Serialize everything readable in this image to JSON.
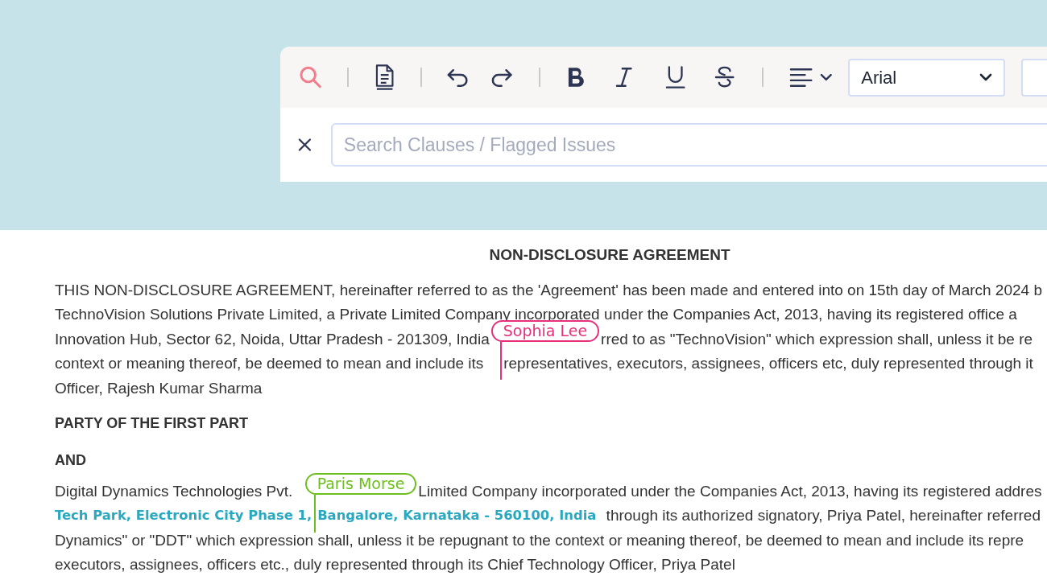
{
  "toolbar": {
    "font": "Arial"
  },
  "search": {
    "placeholder": "Search Clauses / Flagged Issues"
  },
  "document": {
    "title": "NON-DISCLOSURE AGREEMENT",
    "blocks": [
      {
        "kind": "paragraph",
        "lines": [
          [
            {
              "kind": "text",
              "text": "THIS NON-DISCLOSURE AGREEMENT, hereinafter referred to as the 'Agreement' has been made and entered into on 15th day of March 2024 b"
            }
          ],
          [
            {
              "kind": "text",
              "text": "TechnoVision Solutions Private Limited, a Private Limited Company incorporated under the Companies Act, 2013, having its registered office a"
            }
          ],
          [
            {
              "kind": "text",
              "text": "Innovation Hub, Sector 62, Noida, Uttar Pradesh - 201309, India"
            },
            {
              "kind": "cursor",
              "name": "Sophia Lee",
              "color": "#e8307a"
            },
            {
              "kind": "text",
              "text": "rred to as \"TechnoVision\" which expression shall, unless it be re"
            }
          ],
          [
            {
              "kind": "text",
              "text": "context or meaning thereof, be deemed to mean and include its"
            },
            {
              "kind": "text",
              "text": "representatives, executors, assignees, officers etc, duly represented through it"
            }
          ],
          [
            {
              "kind": "text",
              "text": "Officer, Rajesh Kumar Sharma"
            }
          ]
        ]
      },
      {
        "kind": "heading",
        "text": "PARTY OF THE FIRST PART"
      },
      {
        "kind": "heading",
        "text": "AND"
      },
      {
        "kind": "paragraph",
        "lines": [
          [
            {
              "kind": "text",
              "text": "Digital Dynamics Technologies Pvt."
            },
            {
              "kind": "cursor",
              "name": "Paris Morse",
              "color": "#6cbf1e"
            },
            {
              "kind": "text",
              "text": "Limited Company incorporated under the Companies Act, 2013, having its registered addres"
            }
          ],
          [
            {
              "kind": "link",
              "text": "Tech Park, Electronic City Phase 1,"
            },
            {
              "kind": "link",
              "text": "Bangalore, Karnataka - 560100, India"
            },
            {
              "kind": "text",
              "text": " through its authorized signatory, Priya Patel, hereinafter referred"
            }
          ],
          [
            {
              "kind": "text",
              "text": "Dynamics\" or \"DDT\" which expression shall, unless it be repugnant to the context or meaning thereof, be deemed to mean and include its repre"
            }
          ],
          [
            {
              "kind": "text",
              "text": "executors, assignees, officers etc., duly represented through its Chief Technology Officer, Priya Patel"
            }
          ]
        ]
      }
    ]
  }
}
